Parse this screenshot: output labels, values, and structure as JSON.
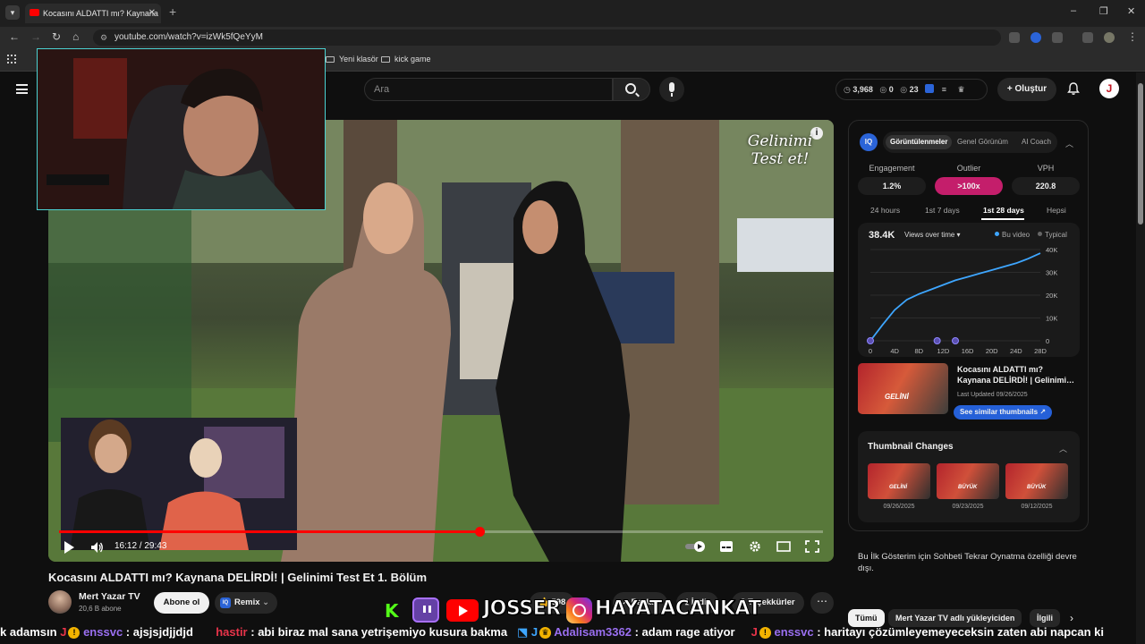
{
  "browser": {
    "tab_title": "Kocasını ALDATTI mı? Kaynana D",
    "url": "youtube.com/watch?v=izWk5fQeYyM",
    "bookmarks": [
      "Yeni klasör",
      "kick game"
    ]
  },
  "header": {
    "search_placeholder": "Ara",
    "stats": {
      "views": "3,968",
      "a": "0",
      "b": "23"
    },
    "create_label": "Oluştur",
    "avatar_letter": "J"
  },
  "video": {
    "watermark_line1": "Gelinimi",
    "watermark_line2": "Test et!",
    "current_time": "16:12 / 29:43",
    "progress": 0.55,
    "title": "Kocasını ALDATTI mı? Kaynana DELİRDİ! | Gelinimi Test Et 1. Bölüm"
  },
  "channel": {
    "name": "Mert Yazar TV",
    "subs": "20,6 B abone",
    "subscribe_label": "Abone ol",
    "remix_label": "Remix",
    "remix_icon_text": "IQ"
  },
  "actions": {
    "likes": "598",
    "share": "Paylaş",
    "download": "İndir",
    "thanks": "Teşekkürler",
    "more": "⋯"
  },
  "iq": {
    "logo": "IQ",
    "tabs": [
      "Görüntülenmeler",
      "Genel Görünüm",
      "AI Coach"
    ],
    "metrics": [
      {
        "label": "Engagement",
        "value": "1.2%"
      },
      {
        "label": "Outlier",
        "value": ">100x"
      },
      {
        "label": "VPH",
        "value": "220.8"
      }
    ],
    "ranges": [
      "24 hours",
      "1st 7 days",
      "1st 28 days",
      "Hepsi"
    ],
    "total": "38.4K",
    "mode": "Views over time ▾",
    "legend_this": "Bu video",
    "legend_typical": "Typical",
    "video_title": "Kocasını ALDATTI mı? Kaynana DELİRDİ! | Gelinimi…",
    "last_updated": "Last Updated 09/26/2025",
    "similar_label": "See similar thumbnails ↗",
    "thumb_text": "GELİNİ",
    "changes_title": "Thumbnail Changes",
    "changes": [
      {
        "text": "GELİNİ",
        "date": "09/26/2025"
      },
      {
        "text": "BÜYÜK",
        "date": "09/23/2025"
      },
      {
        "text": "BÜYÜK",
        "date": "09/12/2025"
      }
    ],
    "chat_note": "Bu İlk Gösterim için Sohbeti Tekrar Oynatma özelliği devre dışı."
  },
  "chips": [
    "Tümü",
    "Mert Yazar TV adlı yükleyiciden",
    "İlgili"
  ],
  "social": {
    "youtube_name": "JOSSER",
    "instagram_name": "HAYATACANKAT",
    "kick_letter": "K"
  },
  "ticker": {
    "pre": "k adamsın",
    "u1": "enssvc",
    "m1": ": ajsjsjdjjdjd",
    "u2": "hastir",
    "m2": ": abi biraz mal sana yetrişemiyo kusura bakma",
    "u3": "Adalisam3362",
    "m3": ": adam rage atiyor",
    "u4": "enssvc",
    "m4": ": haritayı çözümleyemeyeceksin zaten abi napcan ki"
  },
  "chart_data": {
    "type": "line",
    "title": "",
    "x": [
      0,
      2,
      4,
      6,
      8,
      10,
      12,
      14,
      16,
      18,
      20,
      22,
      24,
      26,
      28
    ],
    "x_ticks": [
      "0",
      "4D",
      "8D",
      "12D",
      "16D",
      "20D",
      "24D",
      "28D"
    ],
    "y_ticks": [
      "40K",
      "30K",
      "20K",
      "10K",
      "0"
    ],
    "ylim": [
      0,
      40000
    ],
    "series": [
      {
        "name": "Bu video",
        "values": [
          0,
          7000,
          13500,
          18000,
          20500,
          22500,
          24500,
          26500,
          28000,
          29500,
          31000,
          32500,
          34000,
          36000,
          38400
        ]
      }
    ],
    "markers_x": [
      0,
      11,
      14
    ],
    "color": "#3ea6ff"
  }
}
